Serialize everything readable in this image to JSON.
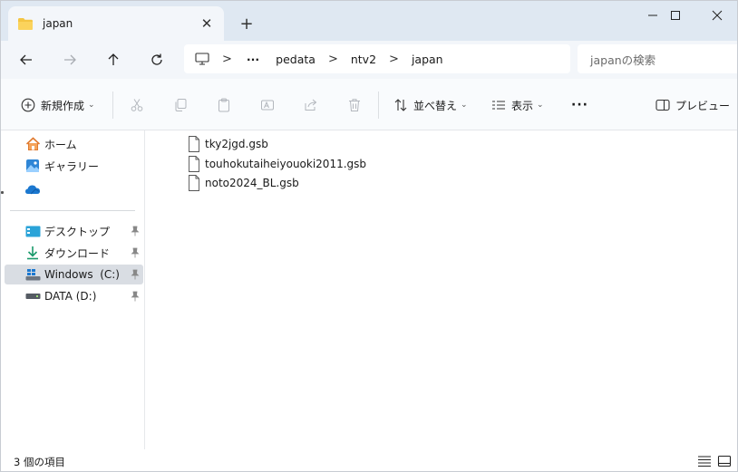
{
  "tab": {
    "title": "japan",
    "close_glyph": "✕",
    "new_glyph": "+"
  },
  "window_controls": {
    "minimize": "—",
    "maximize": "☐",
    "close": "✕"
  },
  "address": {
    "overflow": "···",
    "crumbs": [
      "pedata",
      "ntv2",
      "japan"
    ],
    "separator": ">"
  },
  "search": {
    "placeholder": "japanの検索"
  },
  "toolbar": {
    "new_label": "新規作成",
    "sort_label": "並べ替え",
    "view_label": "表示",
    "more_label": "···",
    "preview_label": "プレビュー"
  },
  "sidebar": {
    "items": [
      {
        "label": "ホーム",
        "icon": "home-icon"
      },
      {
        "label": "ギャラリー",
        "icon": "gallery-icon"
      },
      {
        "label": "",
        "icon": "onedrive-icon"
      },
      {
        "label": "デスクトップ",
        "icon": "desktop-icon",
        "pinned": true
      },
      {
        "label": "ダウンロード",
        "icon": "download-icon",
        "pinned": true
      },
      {
        "label": "Windows  (C:)",
        "icon": "windows-drive-icon",
        "pinned": true,
        "selected": true
      },
      {
        "label": "DATA (D:)",
        "icon": "drive-icon",
        "pinned": true
      }
    ]
  },
  "files": [
    {
      "name": "tky2jgd.gsb"
    },
    {
      "name": "touhokutaiheiyouoki2011.gsb"
    },
    {
      "name": "noto2024_BL.gsb"
    }
  ],
  "status": {
    "count_text": "3 個の項目"
  },
  "colors": {
    "accent": "#0067c0",
    "titlebar": "#dfe8f2",
    "selected": "#d9dde3"
  }
}
